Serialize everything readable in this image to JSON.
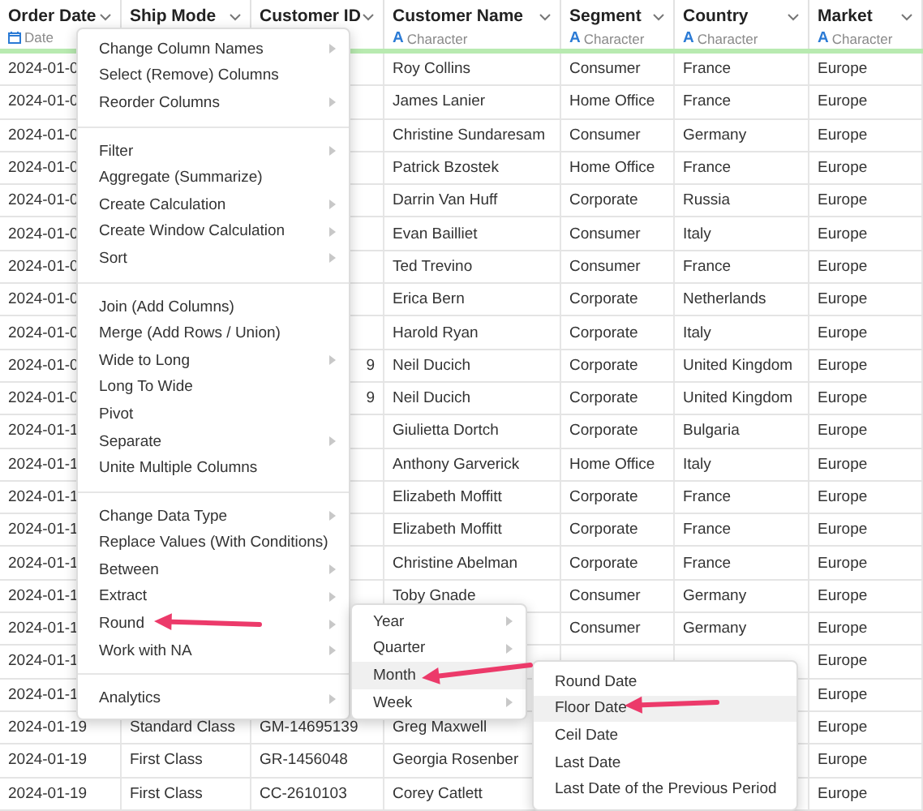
{
  "columns": [
    {
      "title": "Order Date",
      "type": "Date"
    },
    {
      "title": "Ship Mode"
    },
    {
      "title": "Customer ID"
    },
    {
      "title": "Customer Name",
      "type_icon": "A",
      "type": "Character"
    },
    {
      "title": "Segment",
      "type_icon": "A",
      "type": "Character"
    },
    {
      "title": "Country",
      "type_icon": "A",
      "type": "Character"
    },
    {
      "title": "Market",
      "type_icon": "A",
      "type": "Character"
    }
  ],
  "rows": [
    [
      "2024-01-0",
      null,
      null,
      "Roy Collins",
      "Consumer",
      "France",
      "Europe"
    ],
    [
      "2024-01-0",
      null,
      null,
      "James Lanier",
      "Home Office",
      "France",
      "Europe"
    ],
    [
      "2024-01-0",
      null,
      null,
      "Christine Sundaresam",
      "Consumer",
      "Germany",
      "Europe"
    ],
    [
      "2024-01-0",
      null,
      null,
      "Patrick Bzostek",
      "Home Office",
      "France",
      "Europe"
    ],
    [
      "2024-01-0",
      null,
      null,
      "Darrin Van Huff",
      "Corporate",
      "Russia",
      "Europe"
    ],
    [
      "2024-01-0",
      null,
      null,
      "Evan Bailliet",
      "Consumer",
      "Italy",
      "Europe"
    ],
    [
      "2024-01-0",
      null,
      null,
      "Ted Trevino",
      "Consumer",
      "France",
      "Europe"
    ],
    [
      "2024-01-0",
      null,
      null,
      "Erica Bern",
      "Corporate",
      "Netherlands",
      "Europe"
    ],
    [
      "2024-01-0",
      null,
      null,
      "Harold Ryan",
      "Corporate",
      "Italy",
      "Europe"
    ],
    [
      "2024-01-0",
      null,
      "9",
      "Neil Ducich",
      "Corporate",
      "United Kingdom",
      "Europe"
    ],
    [
      "2024-01-0",
      null,
      "9",
      "Neil Ducich",
      "Corporate",
      "United Kingdom",
      "Europe"
    ],
    [
      "2024-01-1",
      null,
      null,
      "Giulietta Dortch",
      "Corporate",
      "Bulgaria",
      "Europe"
    ],
    [
      "2024-01-1",
      null,
      null,
      "Anthony Garverick",
      "Home Office",
      "Italy",
      "Europe"
    ],
    [
      "2024-01-1",
      null,
      null,
      "Elizabeth Moffitt",
      "Corporate",
      "France",
      "Europe"
    ],
    [
      "2024-01-1",
      null,
      null,
      "Elizabeth Moffitt",
      "Corporate",
      "France",
      "Europe"
    ],
    [
      "2024-01-1",
      null,
      null,
      "Christine Abelman",
      "Corporate",
      "France",
      "Europe"
    ],
    [
      "2024-01-1",
      null,
      null,
      "Toby Gnade",
      "Consumer",
      "Germany",
      "Europe"
    ],
    [
      "2024-01-1",
      null,
      null,
      null,
      "Consumer",
      "Germany",
      "Europe"
    ],
    [
      "2024-01-1",
      null,
      null,
      null,
      null,
      null,
      "Europe"
    ],
    [
      "2024-01-1",
      null,
      null,
      null,
      null,
      null,
      "Europe"
    ],
    [
      "2024-01-19",
      "Standard Class",
      "GM-14695139",
      "Greg Maxwell",
      null,
      null,
      "Europe"
    ],
    [
      "2024-01-19",
      "First Class",
      "GR-1456048",
      "Georgia Rosenber",
      null,
      null,
      "Europe"
    ],
    [
      "2024-01-19",
      "First Class",
      "CC-2610103",
      "Corey Catlett",
      null,
      null,
      "Europe"
    ]
  ],
  "menu": {
    "groups": [
      [
        {
          "label": "Change Column Names",
          "submenu": true
        },
        {
          "label": "Select (Remove) Columns",
          "submenu": false
        },
        {
          "label": "Reorder Columns",
          "submenu": true
        }
      ],
      [
        {
          "label": "Filter",
          "submenu": true
        },
        {
          "label": "Aggregate (Summarize)",
          "submenu": false
        },
        {
          "label": "Create Calculation",
          "submenu": true
        },
        {
          "label": "Create Window Calculation",
          "submenu": true
        },
        {
          "label": "Sort",
          "submenu": true
        }
      ],
      [
        {
          "label": "Join (Add Columns)",
          "submenu": false
        },
        {
          "label": "Merge (Add Rows / Union)",
          "submenu": false
        },
        {
          "label": "Wide to Long",
          "submenu": true
        },
        {
          "label": "Long To Wide",
          "submenu": false
        },
        {
          "label": "Pivot",
          "submenu": false
        },
        {
          "label": "Separate",
          "submenu": true
        },
        {
          "label": "Unite Multiple Columns",
          "submenu": false
        }
      ],
      [
        {
          "label": "Change Data Type",
          "submenu": true
        },
        {
          "label": "Replace Values (With Conditions)",
          "submenu": false
        },
        {
          "label": "Between",
          "submenu": true
        },
        {
          "label": "Extract",
          "submenu": true
        },
        {
          "label": "Round",
          "submenu": true
        },
        {
          "label": "Work with NA",
          "submenu": true
        }
      ],
      [
        {
          "label": "Analytics",
          "submenu": true
        }
      ]
    ]
  },
  "round_submenu": [
    {
      "label": "Year",
      "submenu": true,
      "selected": false
    },
    {
      "label": "Quarter",
      "submenu": true,
      "selected": false
    },
    {
      "label": "Month",
      "submenu": false,
      "selected": true
    },
    {
      "label": "Week",
      "submenu": true,
      "selected": false
    }
  ],
  "month_submenu": [
    {
      "label": "Round Date",
      "selected": false
    },
    {
      "label": "Floor Date",
      "selected": true
    },
    {
      "label": "Ceil Date",
      "selected": false
    },
    {
      "label": "Last Date",
      "selected": false
    },
    {
      "label": "Last Date of the Previous Period",
      "selected": false
    }
  ]
}
